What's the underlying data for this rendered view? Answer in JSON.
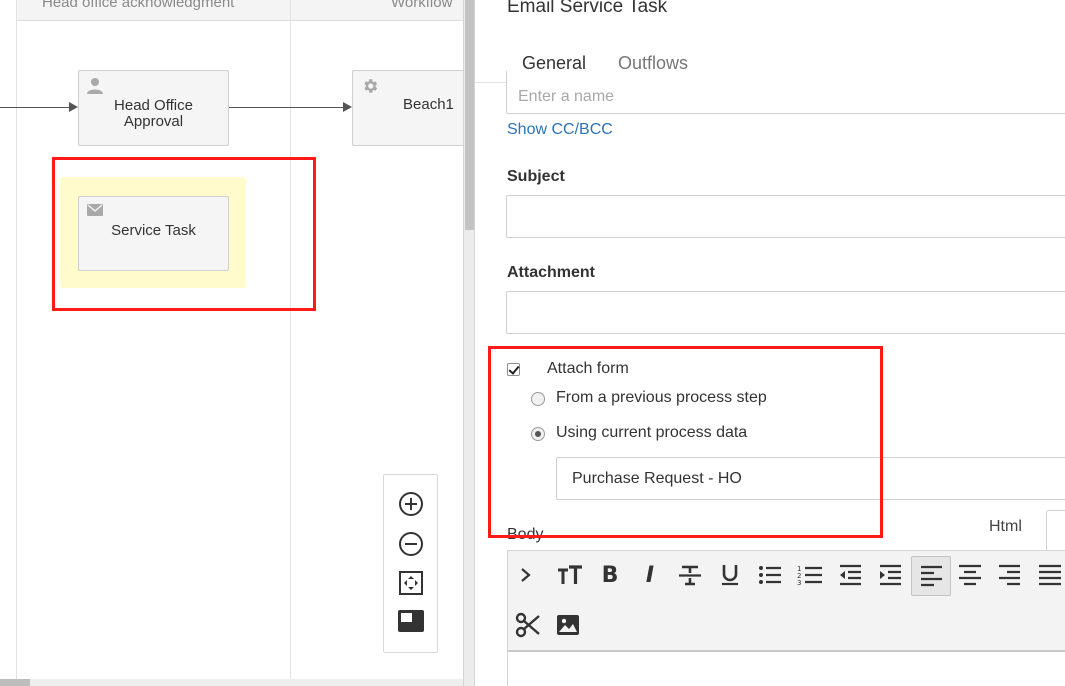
{
  "canvas": {
    "lane_headers": [
      "Head office acknowledgment",
      "Workflow"
    ],
    "nodes": {
      "head_office": "Head Office Approval",
      "beach": "Beach1",
      "service_task": "Service Task"
    }
  },
  "panel": {
    "title": "Email Service Task",
    "tabs": [
      "General",
      "Outflows"
    ],
    "recipient_placeholder": "Enter a name",
    "show_cc_link": "Show CC/BCC",
    "subject_label": "Subject",
    "attachment_label": "Attachment",
    "attach_form_label": "Attach form",
    "attach_form_checked": true,
    "radio_options": [
      "From a previous process step",
      "Using current process data"
    ],
    "radio_selected_index": 1,
    "form_select_value": "Purchase Request - HO",
    "body_label": "Body",
    "editor_mode_tab": "Html"
  },
  "colors": {
    "accent_tab": "#3aa8a0",
    "link": "#2e73b8",
    "annotation": "#ff1a1a",
    "selection_highlight": "#fffbcc"
  },
  "icons": {
    "user": "user-icon",
    "gear": "gear-icon",
    "mail": "mail-icon",
    "zoom_in": "zoom-in-icon",
    "zoom_out": "zoom-out-icon",
    "fit": "fit-to-screen-icon",
    "minimap": "minimap-icon"
  }
}
